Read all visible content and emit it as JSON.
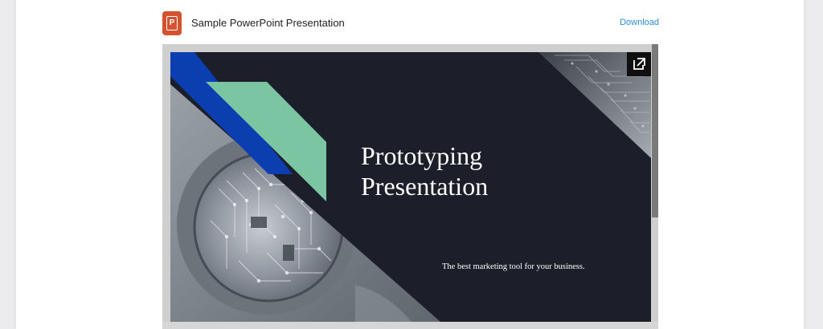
{
  "header": {
    "file_icon_letter": "P",
    "file_title": "Sample PowerPoint Presentation",
    "download_label": "Download"
  },
  "slide": {
    "title_line1": "Prototyping",
    "title_line2": "Presentation",
    "subtitle": "The best marketing tool for your business."
  },
  "icons": {
    "file": "powerpoint-file-icon",
    "popout": "open-in-new-icon"
  },
  "colors": {
    "slide_background": "#1c1f29",
    "accent_blue": "#0b3fb0",
    "accent_green": "#7cc5a3",
    "link": "#2b8fd6",
    "ppt_brand": "#d35230"
  }
}
